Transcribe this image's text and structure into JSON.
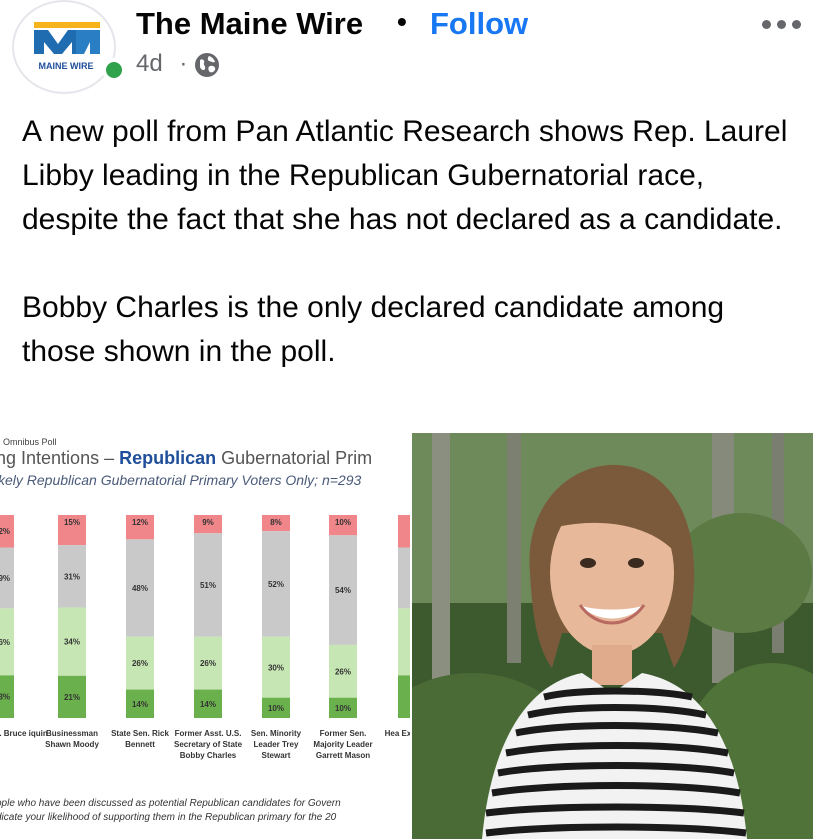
{
  "post": {
    "page_name": "The Maine Wire",
    "separator": "•",
    "follow_label": "Follow",
    "time": "4d",
    "meta_dot": "·",
    "logo_text": "MAINE WIRE",
    "paragraphs": [
      "A new poll from Pan Atlantic Research shows Rep. Laurel Libby leading in the Republican Gubernatorial race, despite the fact that she has not declared as a candidate.",
      "Bobby Charles is the only declared candidate among those shown in the poll."
    ]
  },
  "poll": {
    "small_label": "Omnibus Poll",
    "title_pre": "ng Intentions – ",
    "title_bold": "Republican",
    "title_post": " Gubernatorial Prim",
    "subtitle": "kely Republican Gubernatorial Primary Voters Only; n=293",
    "footnote_1": "ople who have been discussed as potential Republican candidates for Govern",
    "footnote_2": "dicate your likelihood of supporting them in the Republican primary for the 20",
    "colors": {
      "red": "#f0868a",
      "gray": "#c9c9c9",
      "light_green": "#c6e6b3",
      "dark_green": "#6ab04c"
    }
  },
  "chart_data": {
    "type": "bar",
    "stacked": true,
    "categories": [
      "er U.S. Bruce iquin",
      "Businessman Shawn Moody",
      "State Sen. Rick Bennett",
      "Former Asst. U.S. Secretary of State Bobby Charles",
      "Sen. Minority Leader Trey Stewart",
      "Former Sen. Majority Leader Garrett Mason",
      "Hea Exe Jonat"
    ],
    "series": [
      {
        "values": [
          null,
          15,
          12,
          9,
          8,
          10,
          null
        ]
      },
      {
        "values": [
          null,
          31,
          48,
          51,
          52,
          54,
          null
        ]
      },
      {
        "values": [
          null,
          34,
          26,
          26,
          30,
          26,
          null
        ]
      },
      {
        "values": [
          null,
          21,
          14,
          14,
          10,
          10,
          null
        ]
      }
    ],
    "partial_labels": [
      "2%",
      "9%",
      "6%",
      "3%"
    ],
    "ylim": [
      0,
      100
    ]
  }
}
